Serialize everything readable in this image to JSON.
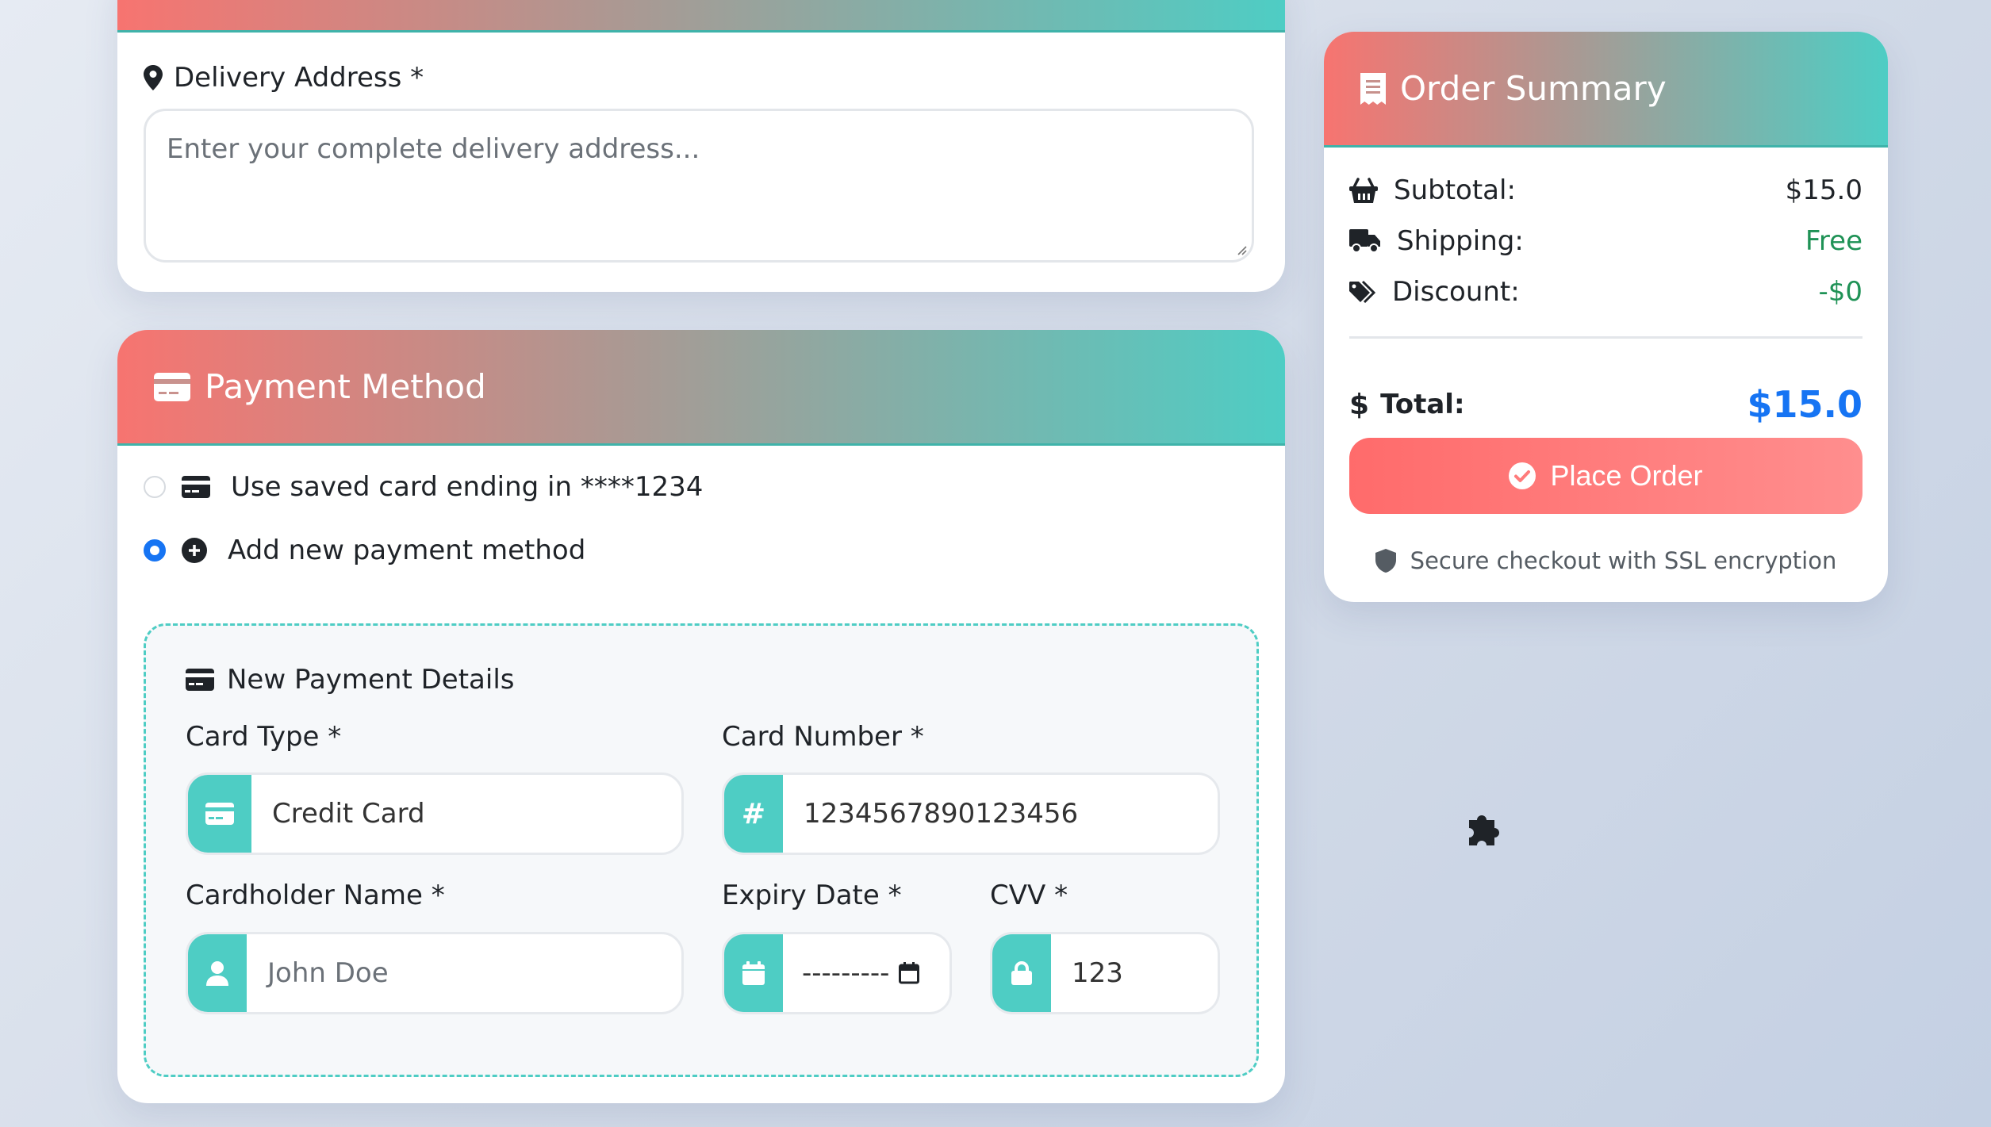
{
  "delivery": {
    "label": "Delivery Address *",
    "placeholder": "Enter your complete delivery address..."
  },
  "payment": {
    "title": "Payment Method",
    "options": [
      {
        "label": "Use saved card ending in ****1234",
        "selected": false,
        "icon": "credit-card-icon"
      },
      {
        "label": "Add new payment method",
        "selected": true,
        "icon": "plus-circle-icon"
      }
    ],
    "new_details": {
      "title": "New Payment Details",
      "card_type": {
        "label": "Card Type *",
        "value": "Credit Card"
      },
      "card_number": {
        "label": "Card Number *",
        "value": "1234567890123456"
      },
      "cardholder": {
        "label": "Cardholder Name *",
        "placeholder": "John Doe"
      },
      "expiry": {
        "label": "Expiry Date *",
        "value": "---------"
      },
      "cvv": {
        "label": "CVV *",
        "value": "123"
      }
    }
  },
  "summary": {
    "title": "Order Summary",
    "subtotal_label": "Subtotal:",
    "subtotal_value": "$15.0",
    "shipping_label": "Shipping:",
    "shipping_value": "Free",
    "discount_label": "Discount:",
    "discount_value": "-$0",
    "total_label": "Total:",
    "total_value": "$15.0",
    "place_order": "Place Order",
    "secure_text": "Secure checkout with SSL encryption"
  },
  "colors": {
    "accent_teal": "#4ecdc4",
    "accent_coral": "#f77470",
    "link_blue": "#1674f3",
    "success_green": "#1f9256"
  }
}
